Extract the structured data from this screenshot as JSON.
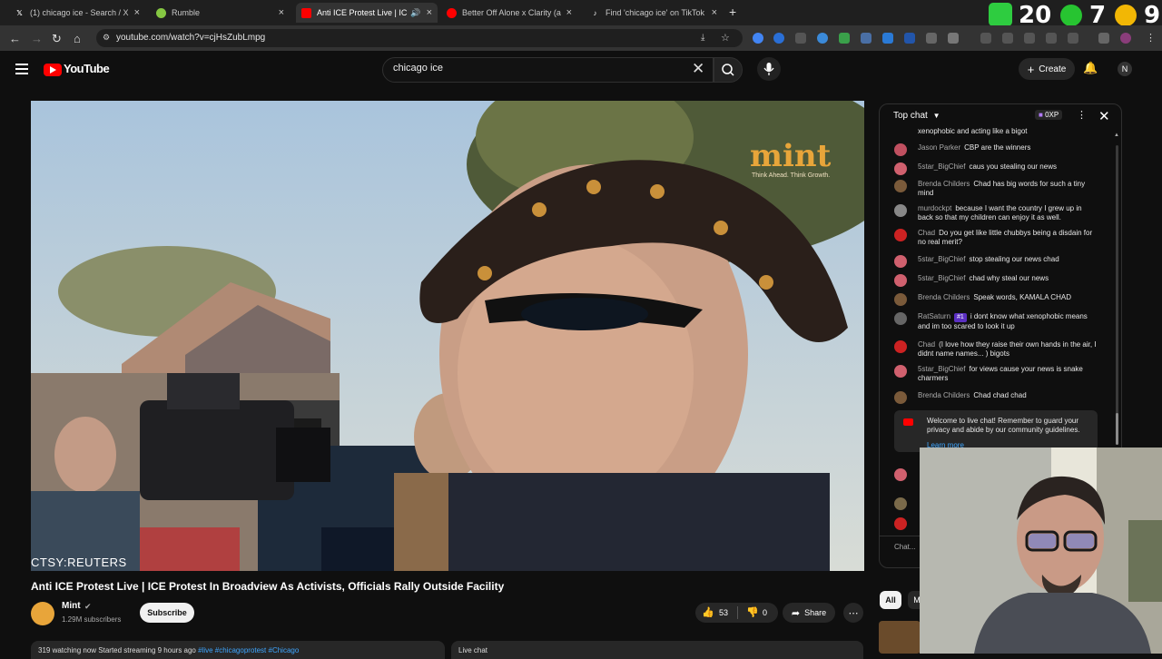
{
  "browser": {
    "tabs": [
      {
        "label": "(1) chicago ice - Search / X",
        "icon": "x-logo-icon",
        "active": false
      },
      {
        "label": "Rumble",
        "icon": "rumble-icon",
        "active": false
      },
      {
        "label": "Anti ICE Protest Live | ICE Pr",
        "icon": "youtube-icon",
        "active": true
      },
      {
        "label": "Better Off Alone x Clarity (agai",
        "icon": "youtube-icon",
        "active": false
      },
      {
        "label": "Find 'chicago ice' on TikTok | Ti",
        "icon": "tiktok-icon",
        "active": false
      }
    ],
    "url": "youtube.com/watch?v=cjHsZubLmpg"
  },
  "overlay_counters": {
    "first": "20",
    "second": "7",
    "third": "9"
  },
  "youtube_header": {
    "logo_text": "YouTube",
    "search_value": "chicago ice",
    "create_label": "Create",
    "avatar_letter": "N"
  },
  "video": {
    "watermark": "mint",
    "watermark_tagline": "Think Ahead. Think Growth.",
    "credit": "CTSY:REUTERS",
    "title": "Anti ICE Protest Live | ICE Protest In Broadview As Activists, Officials Rally Outside Facility",
    "channel_name": "Mint",
    "channel_subs": "1.29M subscribers",
    "subscribe_label": "Subscribe",
    "likes": "53",
    "dislikes": "0",
    "share_label": "Share",
    "description_prefix": "319 watching now  Started streaming 9 hours ago",
    "description_tags": "#live #chicagoprotest #Chicago",
    "live_chat_label": "Live chat"
  },
  "chat": {
    "header_title": "Top chat",
    "xp_badge": "0XP",
    "messages": [
      {
        "author": "",
        "text": "xenophobic and acting like a bigot",
        "avatar_color": "#b34a5a"
      },
      {
        "author": "Jason Parker",
        "text": "CBP are the winners",
        "avatar_color": "#c05060"
      },
      {
        "author": "5star_BigChief",
        "text": "caus you stealing our news",
        "avatar_color": "#d0606e"
      },
      {
        "author": "Brenda Childers",
        "text": "Chad has big words for such a tiny mind",
        "avatar_color": "#7a5a3a"
      },
      {
        "author": "murdockpt",
        "text": "because I want the country I grew up in back so that my children can enjoy it as well.",
        "avatar_color": "#888888"
      },
      {
        "author": "Chad",
        "text": "Do you get like little chubbys being a disdain for no real merit?",
        "avatar_color": "#cc2222"
      },
      {
        "author": "5star_BigChief",
        "text": "stop stealing our news chad",
        "avatar_color": "#d0606e"
      },
      {
        "author": "5star_BigChief",
        "text": "chad why steal our news",
        "avatar_color": "#d0606e"
      },
      {
        "author": "Brenda Childers",
        "text": "Speak words, KAMALA CHAD",
        "avatar_color": "#7a5a3a"
      },
      {
        "author": "RatSaturn",
        "badge": "#1",
        "text": "i dont know what xenophobic means and im too scared to look it up",
        "avatar_color": "#666666"
      },
      {
        "author": "Chad",
        "text": "(I love how they raise their own hands in the air, I didnt name names... ) bigots",
        "avatar_color": "#cc2222"
      },
      {
        "author": "5star_BigChief",
        "text": "for views cause your news is snake charmers",
        "avatar_color": "#d0606e"
      },
      {
        "author": "Brenda Childers",
        "text": "Chad chad chad",
        "avatar_color": "#7a5a3a"
      }
    ],
    "welcome_text": "Welcome to live chat! Remember to guard your privacy and abide by our community guidelines.",
    "learn_more": "Learn more",
    "input_placeholder": "Chat..."
  },
  "recommendations": {
    "chip_all": "All",
    "chip_m": "M"
  },
  "colors": {
    "background": "#0f0f0f",
    "accent_red": "#ff0000",
    "link_blue": "#3ea6ff",
    "mint_orange": "#e8a53a"
  }
}
